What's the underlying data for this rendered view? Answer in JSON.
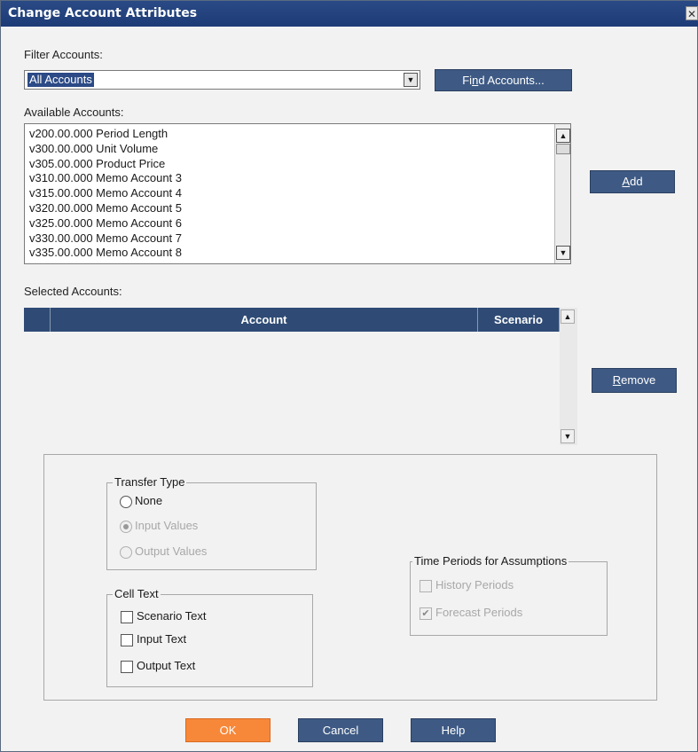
{
  "window": {
    "title": "Change Account Attributes",
    "close_glyph": "✕"
  },
  "filter": {
    "label": "Filter Accounts:",
    "selected": "All Accounts",
    "find_button_pre": "Fi",
    "find_button_ul": "n",
    "find_button_post": "d Accounts..."
  },
  "available": {
    "label": "Available Accounts:",
    "items": [
      "v200.00.000 Period Length",
      "v300.00.000 Unit Volume",
      "v305.00.000 Product Price",
      "v310.00.000 Memo Account 3",
      "v315.00.000 Memo Account 4",
      "v320.00.000 Memo Account 5",
      "v325.00.000 Memo Account 6",
      "v330.00.000 Memo Account 7",
      "v335.00.000 Memo Account 8"
    ],
    "add_button_ul": "A",
    "add_button_post": "dd"
  },
  "selected": {
    "label": "Selected Accounts:",
    "columns": [
      "",
      "Account",
      "Scenario"
    ],
    "remove_button_ul": "R",
    "remove_button_post": "emove"
  },
  "transfer_type": {
    "title": "Transfer Type",
    "options": [
      {
        "label": "None",
        "enabled": true,
        "checked": false
      },
      {
        "label": "Input Values",
        "enabled": false,
        "checked": true
      },
      {
        "label": "Output Values",
        "enabled": false,
        "checked": false
      }
    ]
  },
  "cell_text": {
    "title": "Cell Text",
    "options": [
      {
        "label": "Scenario Text",
        "checked": false
      },
      {
        "label": "Input Text",
        "checked": false
      },
      {
        "label": "Output Text",
        "checked": false
      }
    ]
  },
  "time_periods": {
    "title": "Time Periods for Assumptions",
    "options": [
      {
        "label": "History Periods",
        "enabled": false,
        "checked": false
      },
      {
        "label": "Forecast Periods",
        "enabled": false,
        "checked": true
      }
    ]
  },
  "footer": {
    "ok": "OK",
    "cancel": "Cancel",
    "help": "Help"
  },
  "colors": {
    "titlebar": "#1d3b76",
    "button": "#3e5a84",
    "ok_button": "#f7883a",
    "grid_header": "#2f4b75"
  },
  "icons": {
    "dropdown": "chevron-down-icon",
    "scroll_up": "arrow-up-icon",
    "scroll_down": "arrow-down-icon",
    "close": "close-icon"
  }
}
